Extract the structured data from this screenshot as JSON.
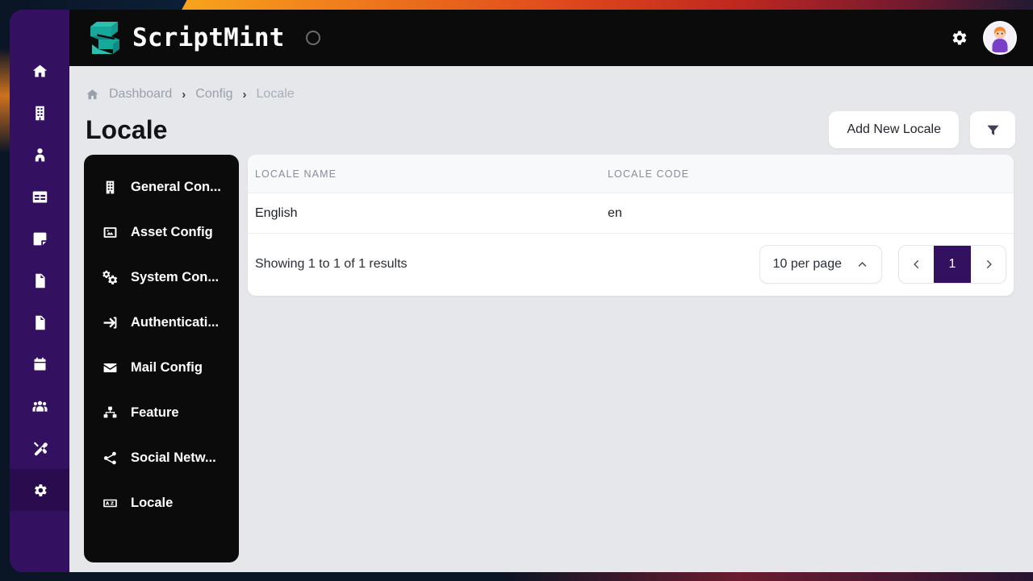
{
  "brand": {
    "name": "ScriptMint",
    "logo_icon": "scriptmint-logo",
    "spinner_icon": "loading-spinner"
  },
  "header": {
    "gear_icon": "gear-icon",
    "avatar_icon": "user-avatar"
  },
  "breadcrumb": {
    "home_icon": "home-icon",
    "items": [
      {
        "label": "Dashboard"
      },
      {
        "label": "Config"
      },
      {
        "label": "Locale"
      }
    ],
    "separator": "›"
  },
  "page": {
    "title": "Locale",
    "add_button": "Add New Locale",
    "filter_icon": "filter-icon"
  },
  "rail": {
    "items": [
      {
        "icon": "home-icon"
      },
      {
        "icon": "building-icon"
      },
      {
        "icon": "user-tie-icon"
      },
      {
        "icon": "table-icon"
      },
      {
        "icon": "sticky-note-icon"
      },
      {
        "icon": "file-image-icon"
      },
      {
        "icon": "file-contract-icon"
      },
      {
        "icon": "calendar-icon"
      },
      {
        "icon": "users-icon"
      },
      {
        "icon": "tools-icon"
      },
      {
        "icon": "gear-icon"
      }
    ],
    "active_index": 10
  },
  "config_menu": {
    "items": [
      {
        "label": "General Con...",
        "icon": "building-icon"
      },
      {
        "label": "Asset Config",
        "icon": "image-icon"
      },
      {
        "label": "System Con...",
        "icon": "cogs-icon"
      },
      {
        "label": "Authenticati...",
        "icon": "sign-in-icon"
      },
      {
        "label": "Mail Config",
        "icon": "envelope-icon"
      },
      {
        "label": "Feature",
        "icon": "sitemap-icon"
      },
      {
        "label": "Social Netw...",
        "icon": "share-nodes-icon"
      },
      {
        "label": "Locale",
        "icon": "language-icon"
      }
    ]
  },
  "table": {
    "columns": [
      "LOCALE NAME",
      "LOCALE CODE"
    ],
    "rows": [
      {
        "name": "English",
        "code": "en"
      }
    ]
  },
  "footer": {
    "showing": "Showing 1 to 1 of 1 results",
    "per_page": "10 per page",
    "per_page_caret_icon": "chevron-up-icon",
    "prev_icon": "chevron-left-icon",
    "next_icon": "chevron-right-icon",
    "pages": [
      "1"
    ],
    "active_page": "1"
  },
  "colors": {
    "sidebar_purple": "#341060",
    "sidebar_active": "#2a0c4e",
    "header_black": "#0b0b0b",
    "page_bg": "#e6e7eb",
    "accent_teal": "#17a398",
    "card_white": "#ffffff"
  }
}
